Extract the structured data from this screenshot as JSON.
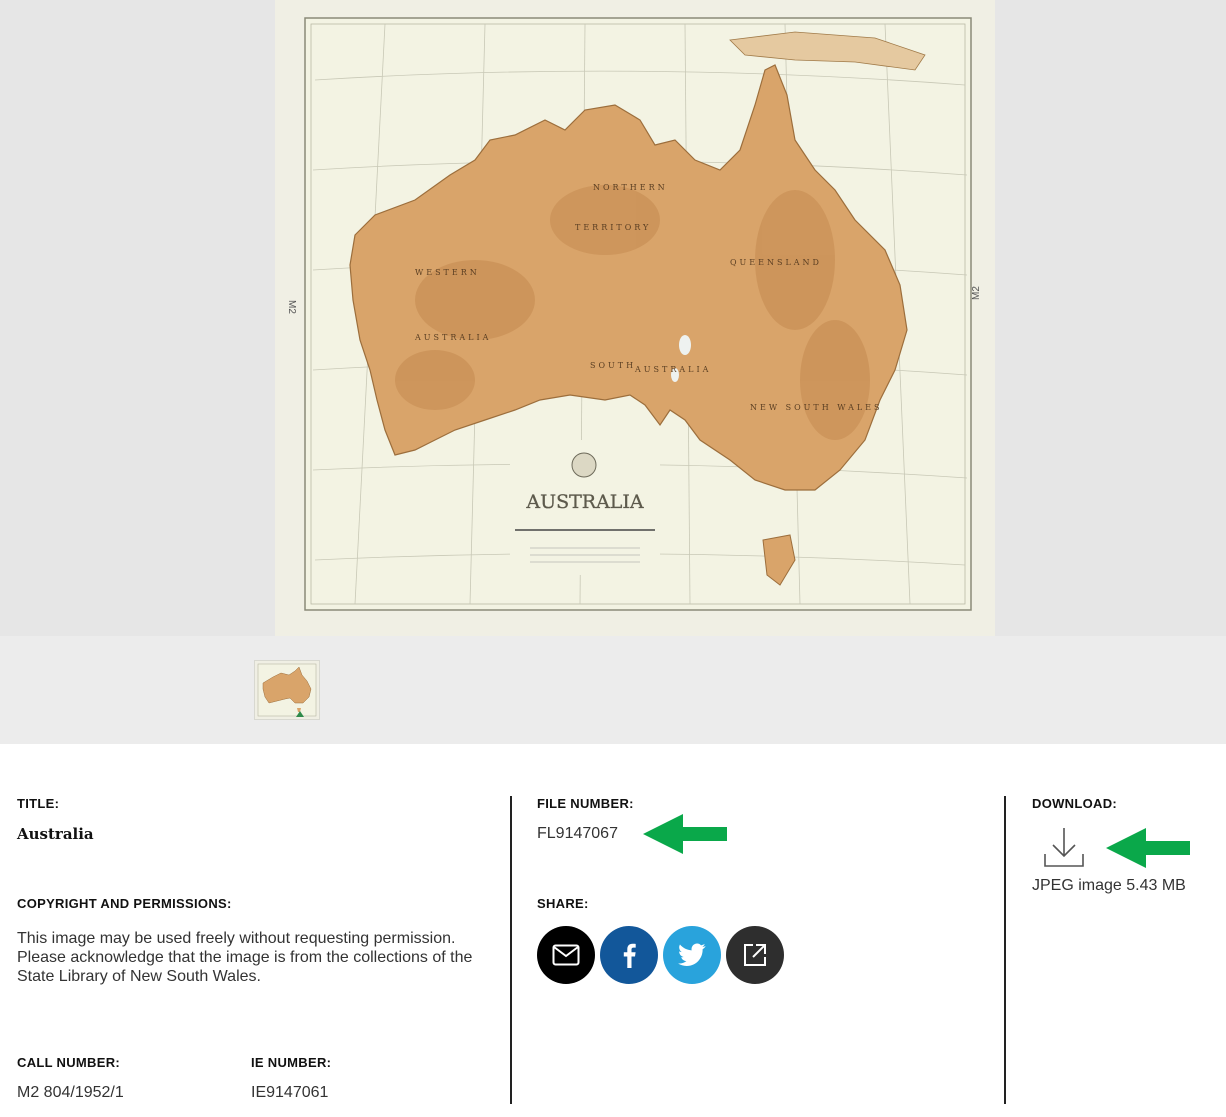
{
  "map": {
    "title": "AUSTRALIA",
    "regions": [
      "NORTHERN",
      "TERRITORY",
      "WESTERN",
      "AUSTRALIA",
      "QUEENSLAND",
      "SOUTH",
      "AUSTRALIA",
      "NEW SOUTH WALES"
    ],
    "side_label": "M2"
  },
  "details": {
    "title_label": "TITLE:",
    "title_value": "Australia",
    "copyright_label": "COPYRIGHT AND PERMISSIONS:",
    "copyright_text": "This image may be used freely without requesting permission. Please acknowledge that the image is from the collections of the State Library of New South Wales.",
    "call_number_label": "CALL NUMBER:",
    "call_number_value": "M2 804/1952/1",
    "ie_number_label": "IE NUMBER:",
    "ie_number_value": "IE9147061",
    "file_number_label": "FILE NUMBER:",
    "file_number_value": "FL9147067",
    "share_label": "SHARE:",
    "download_label": "DOWNLOAD:",
    "download_text": "JPEG image 5.43 MB"
  },
  "share_buttons": [
    "email-icon",
    "facebook-icon",
    "twitter-icon",
    "external-link-icon"
  ],
  "colors": {
    "viewer_bg": "#e6e6e6",
    "land": "#d9a46a",
    "sea": "#f0efe4",
    "facebook": "#12579a",
    "twitter": "#29a3dc",
    "annotation_arrow": "#0aa84a"
  }
}
